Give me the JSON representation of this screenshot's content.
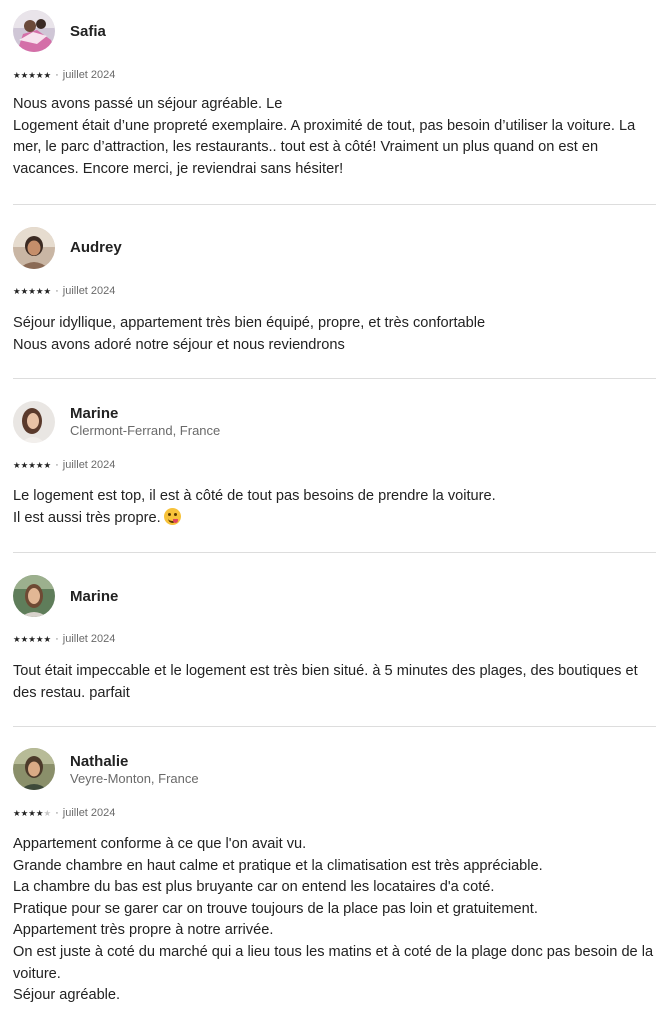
{
  "colors": {
    "text": "#222222",
    "muted": "#6a6a6a",
    "divider": "#dddddd",
    "star_filled": "#222222",
    "star_empty": "#c7c7c7"
  },
  "reviews": [
    {
      "name": "Safia",
      "location": "",
      "rating": 5,
      "date": "juillet 2024",
      "lines": [
        "Nous avons passé un séjour agréable. Le",
        "Logement était d’une propreté exemplaire. A proximité de tout, pas besoin d’utiliser la voiture. La",
        "mer, le parc d’attraction, les restaurants.. tout est à côté! Vraiment un plus quand on est en",
        "vacances. Encore merci, je reviendrai sans hésiter!"
      ]
    },
    {
      "name": "Audrey",
      "location": "",
      "rating": 5,
      "date": "juillet 2024",
      "lines": [
        "Séjour idyllique, appartement très bien équipé, propre, et très confortable",
        "Nous avons adoré notre séjour et nous reviendrons"
      ]
    },
    {
      "name": "Marine",
      "location": "Clermont-Ferrand, France",
      "rating": 5,
      "date": "juillet 2024",
      "lines": [
        "Le logement est top, il est à côté de tout pas besoins de prendre la voiture.",
        "Il est aussi très propre."
      ],
      "emoji_icon": "face-savoring-food-icon"
    },
    {
      "name": "Marine",
      "location": "",
      "rating": 5,
      "date": "juillet 2024",
      "lines": [
        "Tout était impeccable et le logement est très bien situé. à 5 minutes des plages, des boutiques et",
        "des restau. parfait"
      ]
    },
    {
      "name": "Nathalie",
      "location": "Veyre-Monton, France",
      "rating": 4,
      "date": "juillet 2024",
      "lines": [
        "Appartement conforme à ce que l'on avait vu.",
        "Grande chambre en haut calme et pratique et la climatisation est très appréciable.",
        "La chambre du bas est plus bruyante car on entend les locataires d'a coté.",
        "Pratique pour se garer car on trouve toujours de la place pas loin et gratuitement.",
        "Appartement très propre à notre arrivée.",
        "On est juste à coté du marché qui a lieu tous les matins et à coté de la plage donc pas besoin de la",
        "voiture.",
        "Séjour agréable."
      ]
    }
  ],
  "star_glyph": "★",
  "separator": "·"
}
